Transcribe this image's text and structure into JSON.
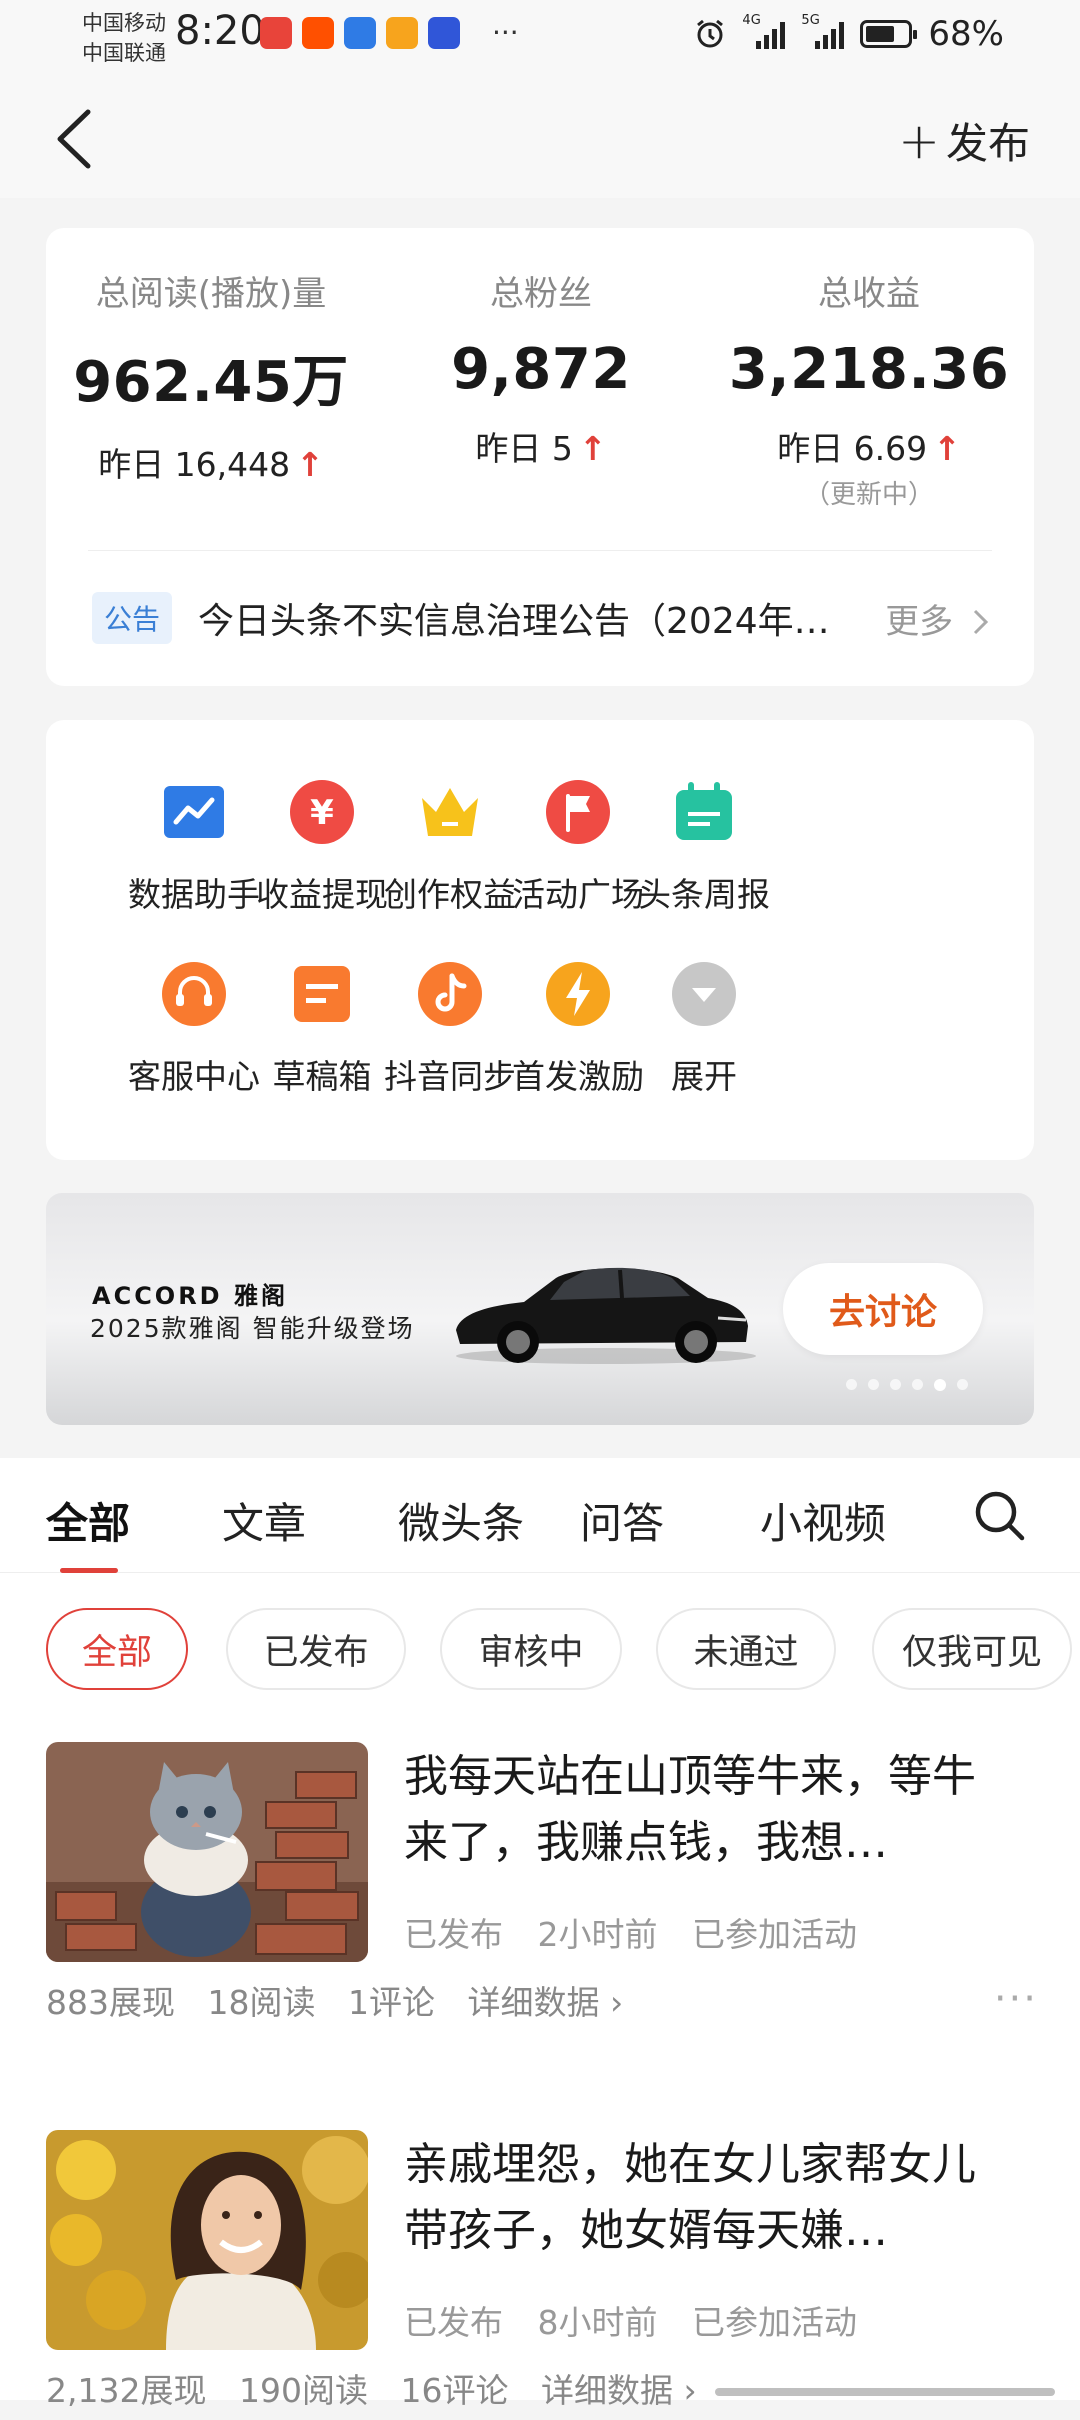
{
  "status_bar": {
    "carrier1": "中国移动",
    "carrier2": "中国联通",
    "time": "8:20",
    "more": "···",
    "network1": "4G",
    "network2": "5G",
    "battery": "68%",
    "battery_level": 0.68,
    "app_icons": [
      {
        "name": "huawei-app-icon",
        "color": "#e8443a"
      },
      {
        "name": "taobao-app-icon",
        "color": "#ff5000"
      },
      {
        "name": "browser-app-icon",
        "color": "#2f7be5"
      },
      {
        "name": "video-app-icon",
        "color": "#f7a41d"
      },
      {
        "name": "baidu-app-icon",
        "color": "#3056d8"
      }
    ]
  },
  "nav": {
    "back_icon": "chevron-left-icon",
    "publish_plus": "+",
    "publish_label": "发布"
  },
  "stats": {
    "items": [
      {
        "label": "总阅读(播放)量",
        "value": "962.45万",
        "delta": "昨日 16,448",
        "arrow": "↑"
      },
      {
        "label": "总粉丝",
        "value": "9,872",
        "delta": "昨日 5",
        "arrow": "↑"
      },
      {
        "label": "总收益",
        "value": "3,218.36",
        "delta": "昨日 6.69",
        "arrow": "↑",
        "note": "（更新中）"
      }
    ],
    "notice": {
      "tag": "公告",
      "text": "今日头条不实信息治理公告（2024年…",
      "more": "更多"
    }
  },
  "tools": [
    {
      "label": "数据助手",
      "icon": "chart-icon",
      "color": "#2f7be5"
    },
    {
      "label": "收益提现",
      "icon": "yuan-icon",
      "color": "#ef4b44"
    },
    {
      "label": "创作权益",
      "icon": "crown-icon",
      "color": "#f7c21b"
    },
    {
      "label": "活动广场",
      "icon": "flag-icon",
      "color": "#ef4b44"
    },
    {
      "label": "头条周报",
      "icon": "calendar-icon",
      "color": "#26c2a0"
    },
    {
      "label": "客服中心",
      "icon": "headset-icon",
      "color": "#f97a2f"
    },
    {
      "label": "草稿箱",
      "icon": "draft-icon",
      "color": "#f97a2f"
    },
    {
      "label": "抖音同步",
      "icon": "tiktok-icon",
      "color": "#f97a2f"
    },
    {
      "label": "首发激励",
      "icon": "lightning-icon",
      "color": "#f7a41d"
    },
    {
      "label": "展开",
      "icon": "expand-icon",
      "color": "#c7c7c7"
    }
  ],
  "banner": {
    "brand": "ACCORD 雅阁",
    "subtitle": "2025款雅阁 智能升级登场",
    "button": "去讨论",
    "slide_count": 6,
    "active_slide": 4
  },
  "tabs": {
    "items": [
      "全部",
      "文章",
      "微头条",
      "问答",
      "小视频"
    ],
    "active": 0
  },
  "chips": {
    "items": [
      "全部",
      "已发布",
      "审核中",
      "未通过",
      "仅我可见"
    ],
    "active": 0
  },
  "articles": [
    {
      "title": "我每天站在山顶等牛来，等牛来了，我赚点钱，我想…",
      "status": "已发布",
      "time": "2小时前",
      "activity": "已参加活动",
      "impressions": "883展现",
      "reads": "18阅读",
      "comments": "1评论",
      "details": "详细数据 ›",
      "more": "···"
    },
    {
      "title": "亲戚埋怨，她在女儿家帮女儿带孩子，她女婿每天嫌…",
      "status": "已发布",
      "time": "8小时前",
      "activity": "已参加活动",
      "impressions": "2,132展现",
      "reads": "190阅读",
      "comments": "16评论",
      "details": "详细数据 ›"
    }
  ]
}
